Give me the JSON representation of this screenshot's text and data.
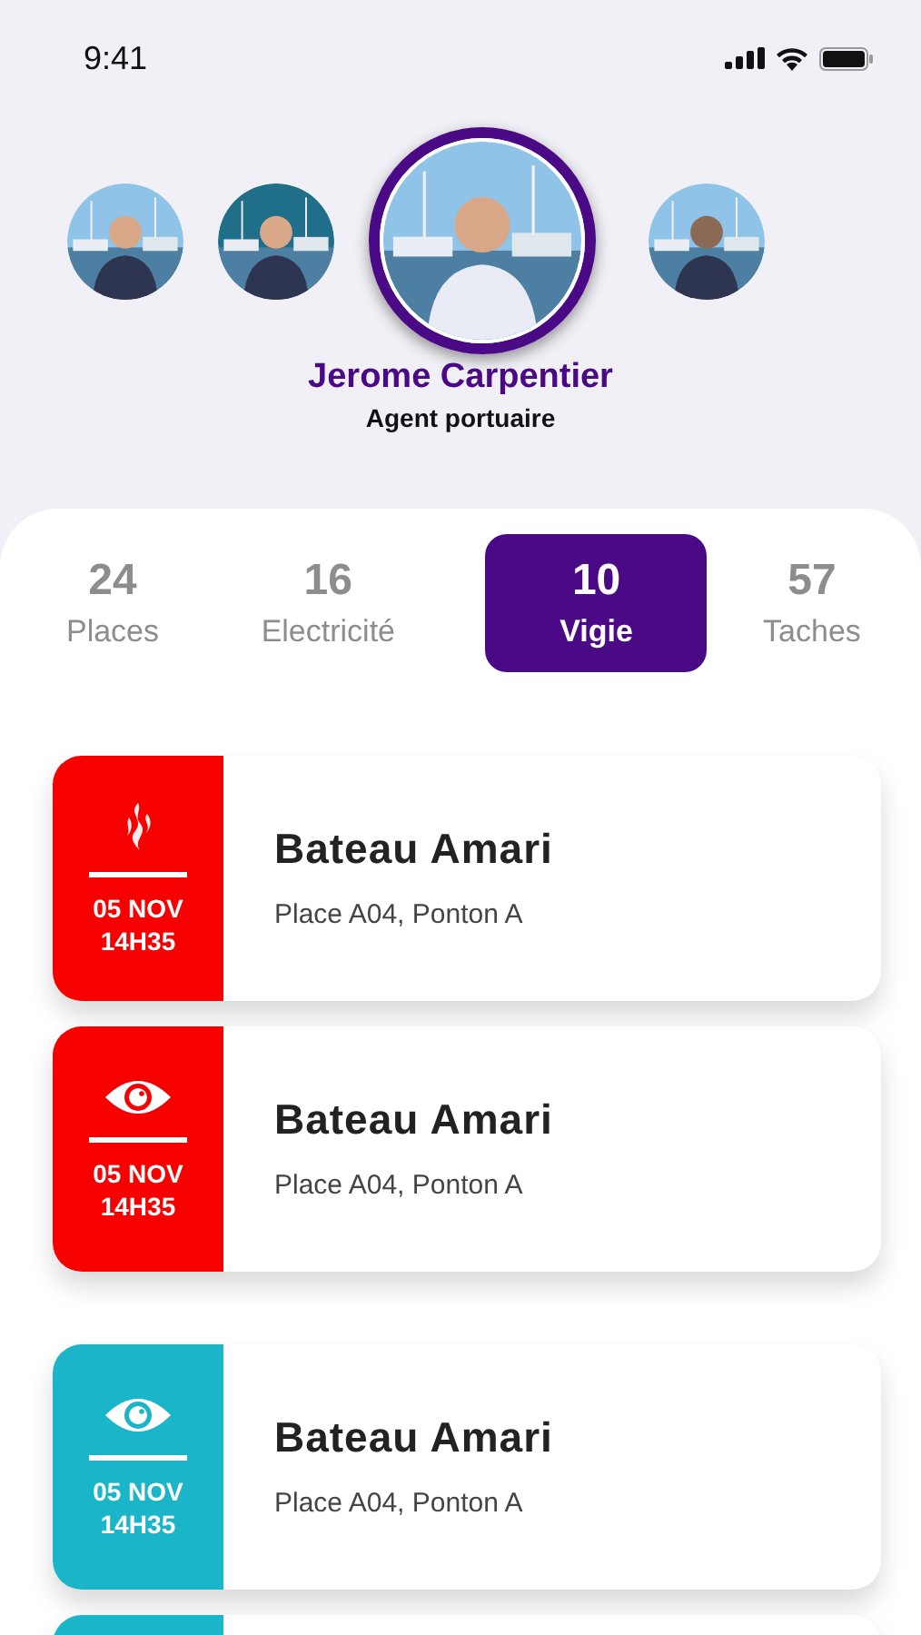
{
  "status_bar": {
    "time": "9:41"
  },
  "people": [
    {
      "selected": false
    },
    {
      "selected": false
    },
    {
      "selected": true
    },
    {
      "selected": false
    }
  ],
  "profile": {
    "name": "Jerome Carpentier",
    "role": "Agent portuaire"
  },
  "tabs": [
    {
      "count": "24",
      "label": "Places",
      "selected": false
    },
    {
      "count": "16",
      "label": "Electricité",
      "selected": false
    },
    {
      "count": "10",
      "label": "Vigie",
      "selected": true
    },
    {
      "count": "57",
      "label": "Taches",
      "selected": false
    }
  ],
  "alerts": [
    {
      "kind": "fire",
      "color": "#f60000",
      "date": "05 NOV",
      "time": "14H35",
      "title": "Bateau Amari",
      "place": "Place A04, Ponton A"
    },
    {
      "kind": "eye",
      "color": "#f60000",
      "date": "05 NOV",
      "time": "14H35",
      "title": "Bateau Amari",
      "place": "Place A04, Ponton A"
    },
    {
      "kind": "eye",
      "color": "#1ab5c9",
      "date": "05 NOV",
      "time": "14H35",
      "title": "Bateau Amari",
      "place": "Place A04, Ponton A"
    },
    {
      "kind": "partial",
      "color": "#1ab5c9"
    }
  ]
}
